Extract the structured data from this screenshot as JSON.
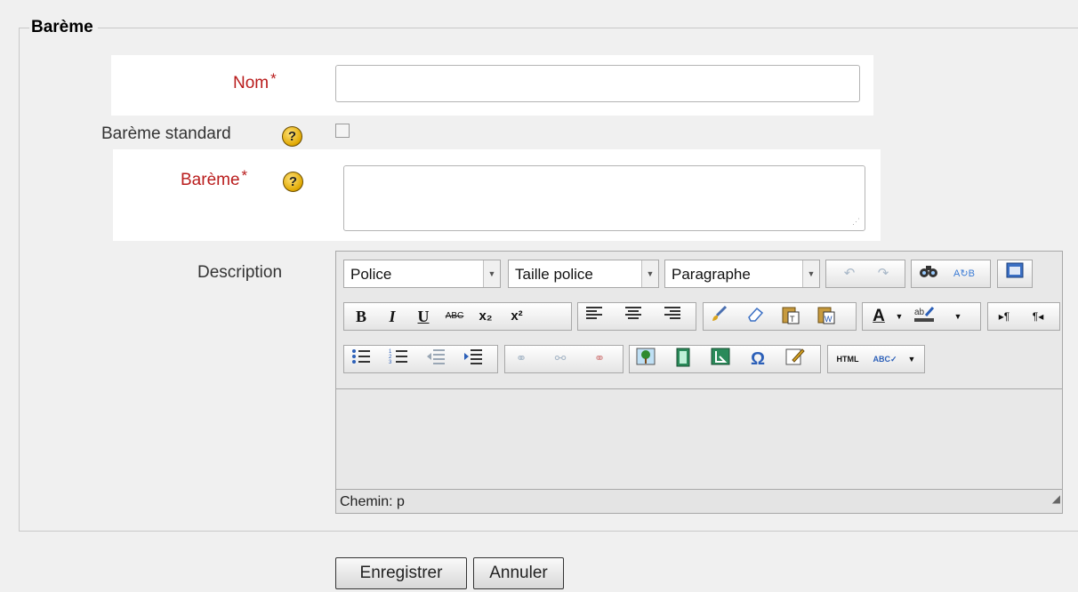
{
  "section": {
    "legend": "Barème"
  },
  "fields": {
    "name": {
      "label": "Nom",
      "required_marker": "*",
      "value": ""
    },
    "standard": {
      "label": "Barème standard",
      "help": "?"
    },
    "scale": {
      "label": "Barème",
      "required_marker": "*",
      "help": "?",
      "value": ""
    },
    "description": {
      "label": "Description"
    }
  },
  "editor": {
    "font_select": "Police",
    "size_select": "Taille police",
    "format_select": "Paragraphe",
    "path_label": "Chemin: p",
    "buttons": {
      "bold": "B",
      "italic": "I",
      "underline": "U",
      "strike": "ABC",
      "subscript": "x₂",
      "superscript": "x²",
      "omega": "Ω",
      "html": "HTML",
      "spell": "ABC"
    }
  },
  "actions": {
    "save": "Enregistrer",
    "cancel": "Annuler"
  }
}
